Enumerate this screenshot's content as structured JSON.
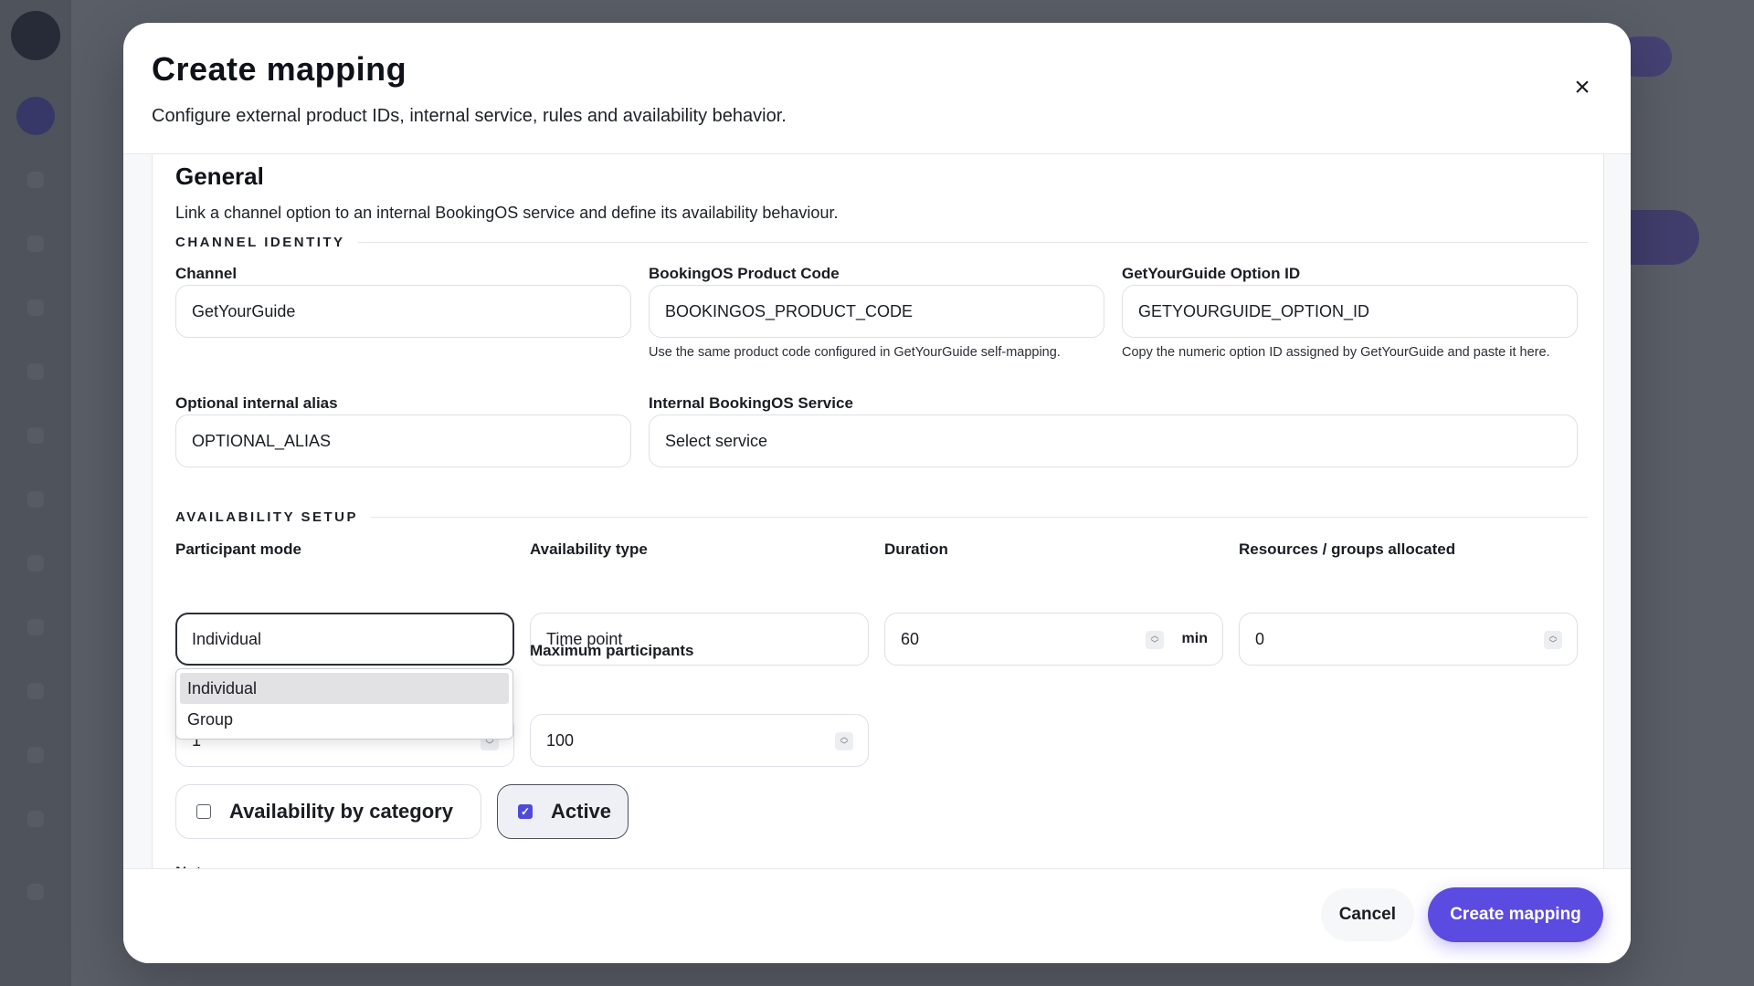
{
  "modal": {
    "title": "Create mapping",
    "subtitle": "Configure external product IDs, internal service, rules and availability behavior.",
    "close_icon": "×"
  },
  "section": {
    "title": "General",
    "description": "Link a channel option to an internal BookingOS service and define its availability behaviour."
  },
  "channel_identity": {
    "group_label": "CHANNEL IDENTITY",
    "channel": {
      "label": "Channel",
      "value": "GetYourGuide"
    },
    "product_code": {
      "label": "BookingOS Product Code",
      "value": "BOOKINGOS_PRODUCT_CODE",
      "helper": "Use the same product code configured in GetYourGuide self-mapping."
    },
    "option_id": {
      "label": "GetYourGuide Option ID",
      "value": "GETYOURGUIDE_OPTION_ID",
      "helper": "Copy the numeric option ID assigned by GetYourGuide and paste it here."
    },
    "alias": {
      "label": "Optional internal alias",
      "value": "OPTIONAL_ALIAS"
    },
    "service": {
      "label": "Internal BookingOS Service",
      "value": "Select service"
    }
  },
  "availability_setup": {
    "group_label": "AVAILABILITY SETUP",
    "participant_mode": {
      "label": "Participant mode",
      "value": "Individual",
      "options": [
        "Individual",
        "Group"
      ],
      "hidden_field_value": "1"
    },
    "availability_type": {
      "label": "Availability type",
      "value": "Time point"
    },
    "duration": {
      "label": "Duration",
      "value": "60",
      "unit": "min"
    },
    "resources": {
      "label": "Resources / groups allocated",
      "value": "0"
    },
    "max_participants": {
      "label": "Maximum participants",
      "value": "100"
    }
  },
  "toggles": {
    "by_category": {
      "label": "Availability by category",
      "checked": false
    },
    "active": {
      "label": "Active",
      "checked": true,
      "check_glyph": "✓"
    }
  },
  "notes": {
    "label": "Notes"
  },
  "footer": {
    "cancel_label": "Cancel",
    "submit_label": "Create mapping"
  },
  "colors": {
    "accent": "#5b4be0",
    "checkbox_checked": "#4f4bd8"
  }
}
